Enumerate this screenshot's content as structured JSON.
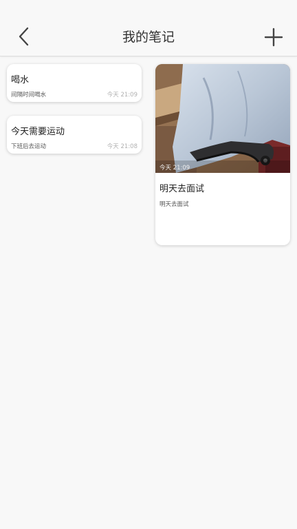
{
  "header": {
    "title": "我的笔记",
    "back_icon": "chevron-left-icon",
    "add_icon": "plus-icon"
  },
  "notes": [
    {
      "title": "喝水",
      "content": "间隔时间喝水",
      "time": "今天 21:09"
    },
    {
      "title": "今天需要运动",
      "content": "下班后去运动",
      "time": "今天 21:08"
    },
    {
      "title": "明天去面试",
      "content": "明天去面试",
      "time": "今天 21:09",
      "has_image": true
    }
  ],
  "colors": {
    "background": "#f8f8f8",
    "card": "#ffffff",
    "title_text": "#333333",
    "time_text": "#b0b0b0"
  }
}
